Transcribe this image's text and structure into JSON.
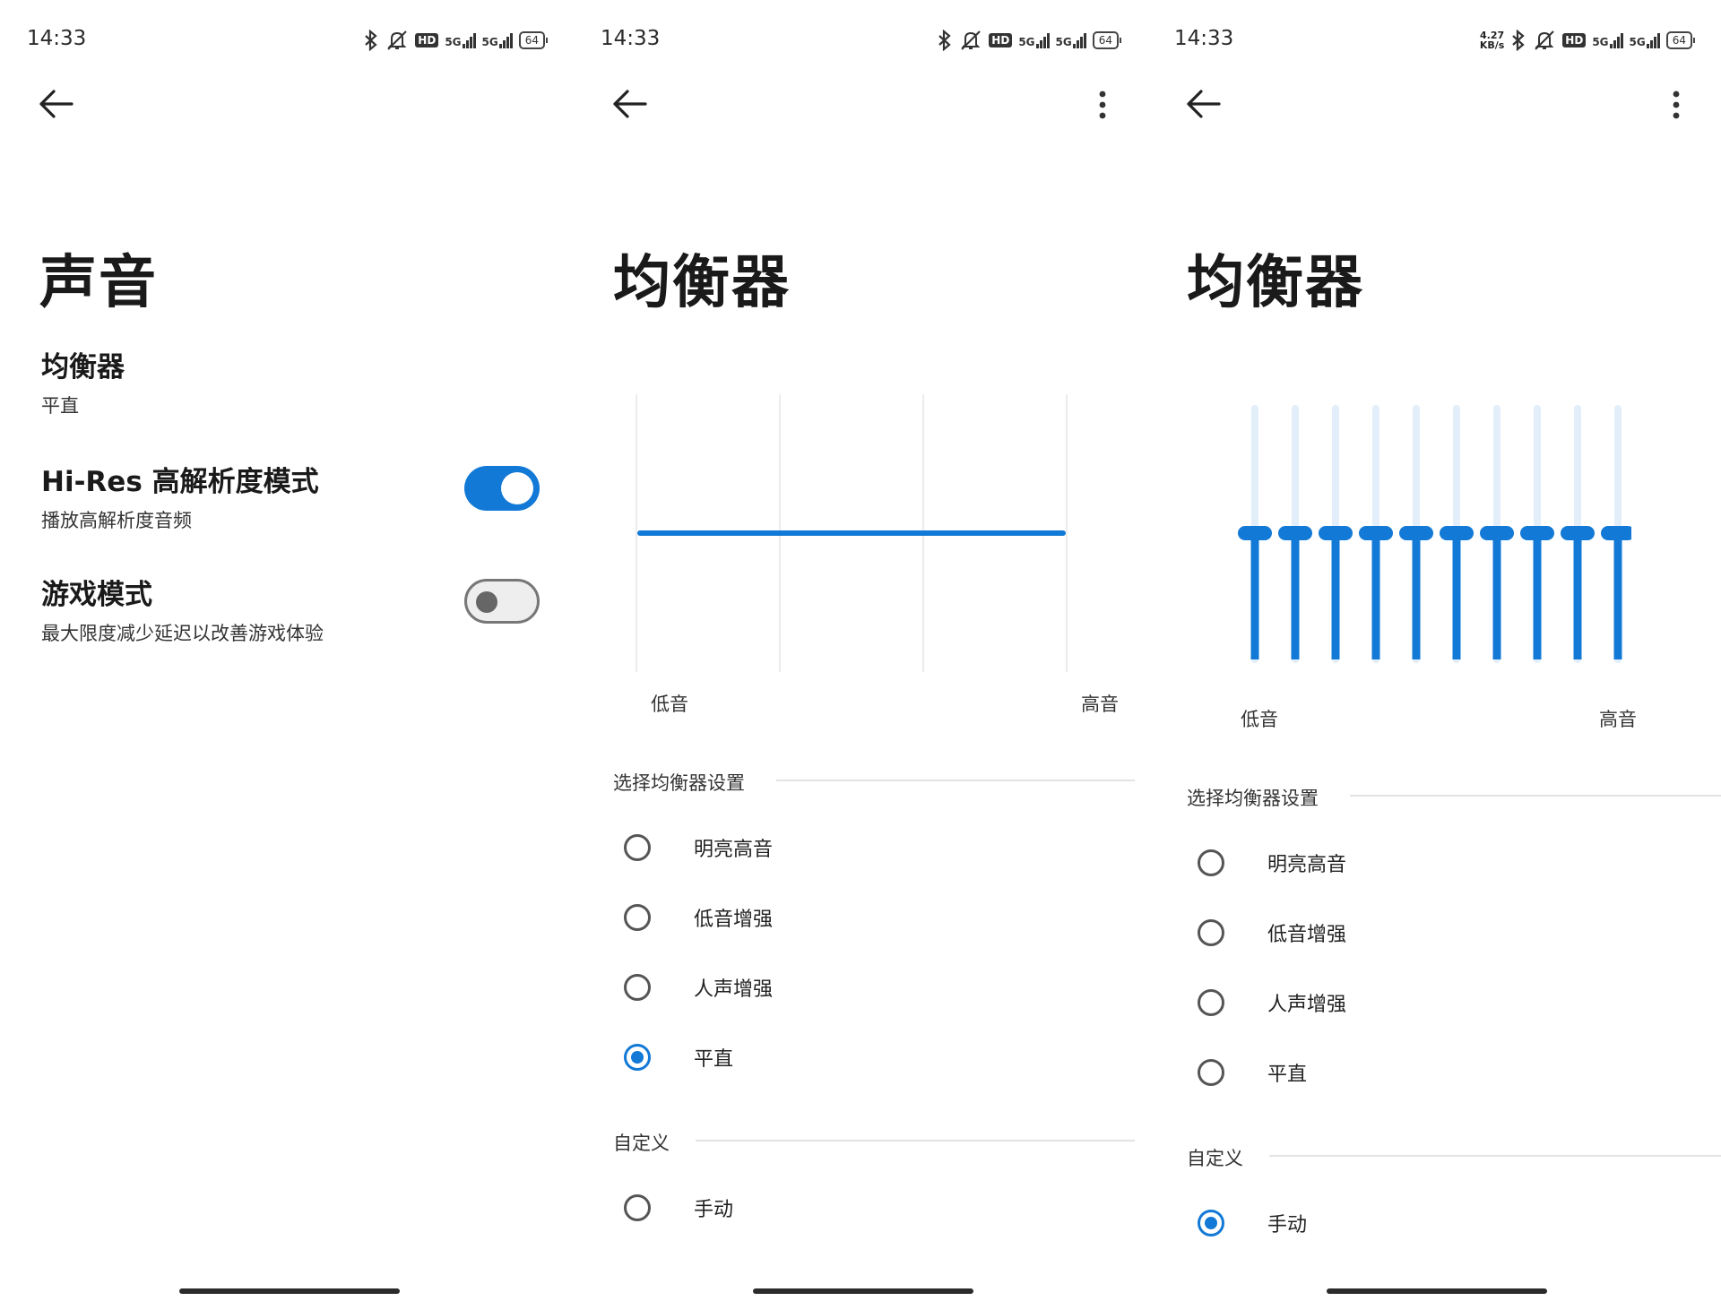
{
  "status_bar": {
    "time": "14:33",
    "speed_value": "4.27",
    "speed_unit": "KB/s",
    "hd": "HD",
    "net1": "5G",
    "net2": "5G",
    "battery": "64"
  },
  "sound_screen": {
    "title": "声音",
    "equalizer": {
      "label": "均衡器",
      "value": "平直"
    },
    "hires": {
      "label": "Hi-Res 高解析度模式",
      "desc": "播放高解析度音频",
      "enabled": true
    },
    "game_mode": {
      "label": "游戏模式",
      "desc": "最大限度减少延迟以改善游戏体验",
      "enabled": false
    }
  },
  "equalizer_screen": {
    "title": "均衡器",
    "low_label": "低音",
    "high_label": "高音",
    "preset_section": "选择均衡器设置",
    "presets": [
      "明亮高音",
      "低音增强",
      "人声增强",
      "平直"
    ],
    "custom_section": "自定义",
    "custom_option": "手动",
    "accent_color": "#1279d6"
  },
  "chart_data": [
    {
      "type": "line",
      "screen": "preset-flat",
      "bands": 10,
      "values": [
        0,
        0,
        0,
        0,
        0,
        0,
        0,
        0,
        0,
        0
      ],
      "ylim": [
        -1,
        1
      ],
      "grid": true
    },
    {
      "type": "bar",
      "screen": "manual",
      "bands": 10,
      "values": [
        0,
        0,
        0,
        0,
        0,
        0,
        0,
        0,
        0,
        0
      ],
      "ylim": [
        -1,
        1
      ]
    }
  ]
}
